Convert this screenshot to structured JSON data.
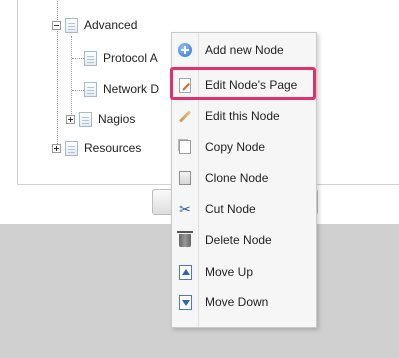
{
  "tree": {
    "items": [
      {
        "label": "Advanced",
        "toggle": "minus"
      },
      {
        "label": "Protocol A",
        "toggle": "none"
      },
      {
        "label": "Network D",
        "toggle": "none"
      },
      {
        "label": "Nagios",
        "toggle": "plus"
      },
      {
        "label": "Resources",
        "toggle": "plus"
      }
    ]
  },
  "context_menu": {
    "items": [
      {
        "label": "Add new Node",
        "icon": "add-icon"
      },
      {
        "label": "Edit Node's Page",
        "icon": "edit-page-icon",
        "highlighted": true
      },
      {
        "label": "Edit this Node",
        "icon": "pencil-icon"
      },
      {
        "label": "Copy Node",
        "icon": "copy-icon"
      },
      {
        "label": "Clone Node",
        "icon": "clone-icon"
      },
      {
        "label": "Cut Node",
        "icon": "scissors-icon"
      },
      {
        "label": "Delete Node",
        "icon": "trash-icon"
      },
      {
        "label": "Move Up",
        "icon": "move-up-icon"
      },
      {
        "label": "Move Down",
        "icon": "move-down-icon"
      }
    ]
  },
  "colors": {
    "highlight_border": "#e0306e",
    "menu_background": "#f6f6f6",
    "lower_area": "#d0d0d0"
  }
}
